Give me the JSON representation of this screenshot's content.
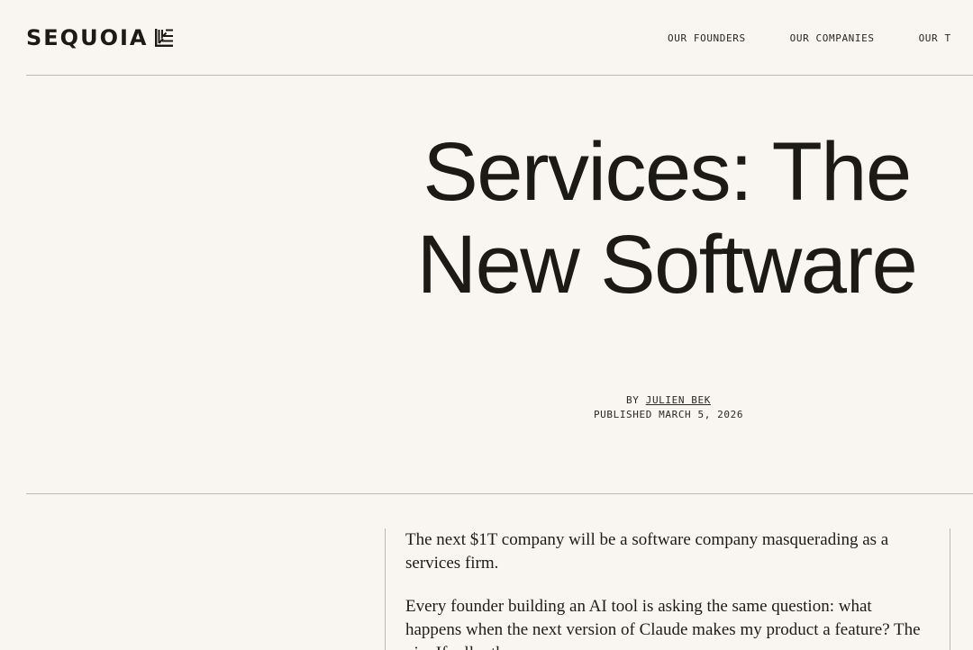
{
  "header": {
    "logo_text": "SEQUOIA",
    "logo_mark_icon": "sequoia-leaf-mark-icon",
    "nav": [
      {
        "label": "OUR FOUNDERS"
      },
      {
        "label": "OUR COMPANIES"
      },
      {
        "label": "OUR T"
      }
    ]
  },
  "article": {
    "title": "Services: The New Software",
    "byline_prefix": "BY",
    "author": "JULIEN BEK",
    "published": "PUBLISHED MARCH 5, 2026",
    "paragraphs": [
      "The next $1T company will be a software company masquerading as a services firm.",
      "Every founder building an AI tool is asking the same question: what happens when the next version of Claude makes my product a feature? The vi... If ...ll ...the ... ... ..."
    ]
  },
  "colors": {
    "background": "#f9f5f0",
    "text": "#1b1a17",
    "rule": "#bdb8b1"
  }
}
